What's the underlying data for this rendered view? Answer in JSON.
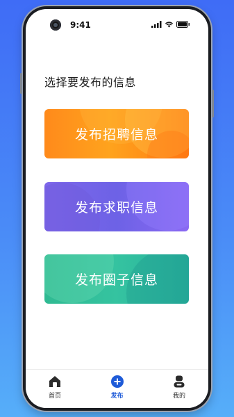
{
  "status_bar": {
    "time": "9:41"
  },
  "page": {
    "heading": "选择要发布的信息"
  },
  "cards": [
    {
      "label": "发布招聘信息",
      "color": "#ff8a1b"
    },
    {
      "label": "发布求职信息",
      "color": "#7e67ea"
    },
    {
      "label": "发布圈子信息",
      "color": "#2fba92"
    }
  ],
  "tabbar": {
    "items": [
      {
        "label": "首页",
        "icon": "home-icon"
      },
      {
        "label": "发布",
        "icon": "plus-circle-icon",
        "active": true
      },
      {
        "label": "我的",
        "icon": "user-icon"
      }
    ]
  },
  "colors": {
    "accent": "#1e5bd8"
  }
}
